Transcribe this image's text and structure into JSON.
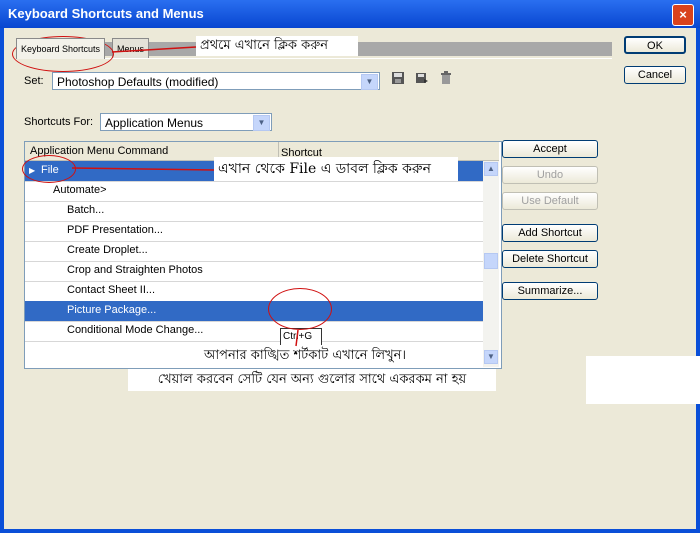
{
  "window": {
    "title": "Keyboard Shortcuts and Menus",
    "close_glyph": "×"
  },
  "tabs": [
    {
      "label": "Keyboard Shortcuts",
      "active": true
    },
    {
      "label": "Menus",
      "active": false
    }
  ],
  "set": {
    "label": "Set:",
    "value": "Photoshop Defaults (modified)"
  },
  "shortcuts_for": {
    "label": "Shortcuts For:",
    "value": "Application Menus"
  },
  "table": {
    "headers": [
      "Application Menu Command",
      "Shortcut"
    ],
    "rows": [
      {
        "label": "File",
        "shortcut": "",
        "selected": true
      },
      {
        "label": "Automate>",
        "shortcut": "",
        "selected": false
      },
      {
        "label": "Batch...",
        "shortcut": "",
        "selected": false
      },
      {
        "label": "PDF Presentation...",
        "shortcut": "",
        "selected": false
      },
      {
        "label": "Create Droplet...",
        "shortcut": "",
        "selected": false
      },
      {
        "label": "Crop and Straighten Photos",
        "shortcut": "",
        "selected": false
      },
      {
        "label": "Contact Sheet II...",
        "shortcut": "",
        "selected": false
      },
      {
        "label": "Picture Package...",
        "shortcut": "Ctrl+G",
        "selected": true
      },
      {
        "label": "Conditional Mode Change...",
        "shortcut": "",
        "selected": false
      }
    ]
  },
  "buttons": {
    "ok": "OK",
    "cancel": "Cancel",
    "accept": "Accept",
    "undo": "Undo",
    "use_default": "Use Default",
    "add_shortcut": "Add Shortcut",
    "delete_shortcut": "Delete Shortcut",
    "summarize": "Summarize..."
  },
  "annotations": {
    "a1": "প্রথমে এখানে ক্লিক করুন",
    "a2": "এখান থেকে File এ ডাবল ক্লিক করুন",
    "a3": "আপনার কাঙ্খিত শর্টকাট এখানে লিখুন।",
    "a4": "খেয়াল করবেন সেটি যেন অন্য গুলোর সাথে একরকম না হয়"
  },
  "colors": {
    "titlebar": "#0846d0",
    "selection": "#316ac5",
    "annotation_circle": "#d01010"
  }
}
